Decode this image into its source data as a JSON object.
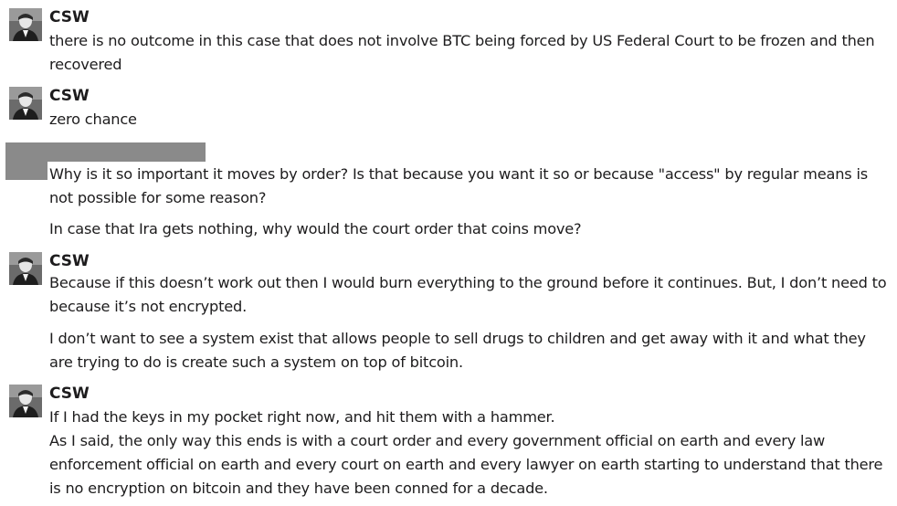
{
  "messages": [
    {
      "author": "CSW",
      "avatar_icon": "person-photo-icon",
      "paragraphs": [
        "there is no outcome in this case that does not involve BTC being forced by US Federal Court to be frozen and then recovered"
      ]
    },
    {
      "author": "CSW",
      "avatar_icon": "person-photo-icon",
      "paragraphs": [
        "zero chance"
      ]
    },
    {
      "author": "",
      "avatar_icon": "redacted-block",
      "paragraphs": [
        "Why is it so important it moves by order? Is that because you want it so or because \"access\" by regular means is not possible for some reason?",
        "In case that Ira gets nothing, why would the court order that coins move?"
      ]
    },
    {
      "author": "CSW",
      "avatar_icon": "person-photo-icon",
      "paragraphs": [
        "Because if this doesn’t work out then I would burn everything to the ground before it continues. But, I don’t need to because it’s not encrypted.",
        "I don’t want to see a system exist that allows people to sell drugs to children and get away with it and what they are trying to do is create such a system on top of bitcoin."
      ]
    },
    {
      "author": "CSW",
      "avatar_icon": "person-photo-icon",
      "paragraphs": [
        "If I had the keys in my pocket right now, and hit them with a hammer.",
        "As I said, the only way this ends is with a court order and every government official on earth and every law enforcement official on earth and every court on earth and every lawyer on earth starting to understand that there is no encryption on bitcoin and they have been conned for a decade."
      ]
    }
  ],
  "colors": {
    "text": "#1d1c1d",
    "background": "#ffffff",
    "redaction": "#8a8a8a"
  }
}
